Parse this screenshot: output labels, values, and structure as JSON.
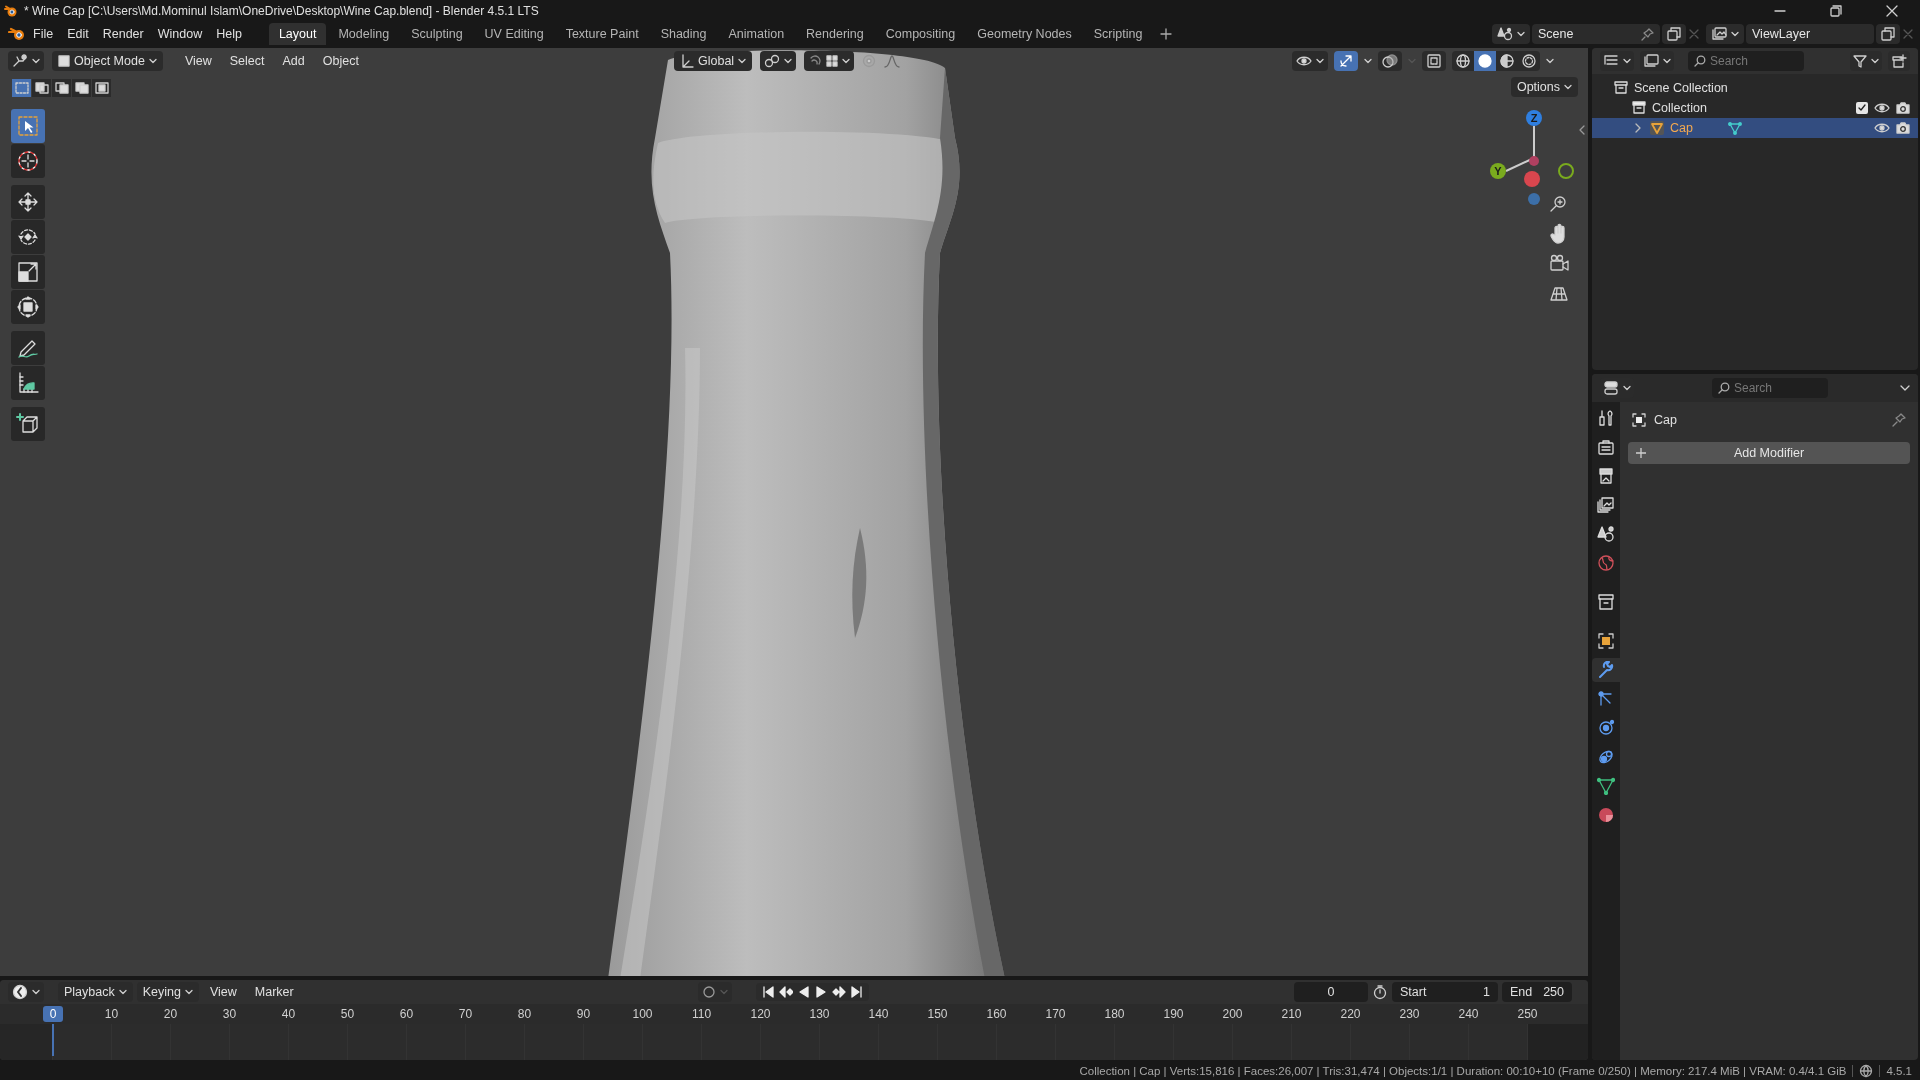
{
  "title_bar": {
    "title": "* Wine Cap [C:\\Users\\Md.Mominul Islam\\OneDrive\\Desktop\\Wine Cap.blend] - Blender 4.5.1 LTS"
  },
  "menu": [
    "File",
    "Edit",
    "Render",
    "Window",
    "Help"
  ],
  "workspaces": [
    {
      "label": "Layout",
      "selected": true
    },
    {
      "label": "Modeling",
      "selected": false
    },
    {
      "label": "Sculpting",
      "selected": false
    },
    {
      "label": "UV Editing",
      "selected": false
    },
    {
      "label": "Texture Paint",
      "selected": false
    },
    {
      "label": "Shading",
      "selected": false
    },
    {
      "label": "Animation",
      "selected": false
    },
    {
      "label": "Rendering",
      "selected": false
    },
    {
      "label": "Compositing",
      "selected": false
    },
    {
      "label": "Geometry Nodes",
      "selected": false
    },
    {
      "label": "Scripting",
      "selected": false
    }
  ],
  "scene": "Scene",
  "view_layer": "ViewLayer",
  "viewport": {
    "mode": "Object Mode",
    "menus": [
      "View",
      "Select",
      "Add",
      "Object"
    ],
    "orientation": "Global",
    "options": "Options",
    "select_modes": [
      {
        "selected": true
      },
      {
        "selected": false
      },
      {
        "selected": false
      },
      {
        "selected": false
      },
      {
        "selected": false
      }
    ],
    "tools": [
      {
        "kind": "select",
        "selected": true
      },
      {
        "kind": "cursor",
        "selected": false
      },
      {
        "kind": "move",
        "selected": false
      },
      {
        "kind": "rotate",
        "selected": false
      },
      {
        "kind": "scale",
        "selected": false
      },
      {
        "kind": "transform",
        "selected": false
      },
      {
        "kind": "annotate",
        "selected": false
      },
      {
        "kind": "measure",
        "selected": false
      },
      {
        "kind": "add-cube",
        "selected": false
      }
    ],
    "shading": [
      {
        "kind": "wireframe",
        "selected": false
      },
      {
        "kind": "solid",
        "selected": true
      },
      {
        "kind": "material",
        "selected": false
      },
      {
        "kind": "rendered",
        "selected": false
      }
    ],
    "gizmo_axes": [
      {
        "label": "Z",
        "color": "#2f7fe0"
      },
      {
        "label": "Y",
        "color": "#7aab1e"
      }
    ],
    "object": {
      "kind": "picture"
    }
  },
  "outliner": {
    "search": {
      "placeholder": "Search"
    },
    "tree": [
      {
        "label": "Scene Collection",
        "kind": "scene",
        "selected": false,
        "children": [
          {
            "label": "Collection",
            "kind": "collection",
            "checked": true,
            "selected": false,
            "children": [
              {
                "label": "Cap",
                "kind": "mesh",
                "selected": true,
                "expanded": false
              }
            ]
          }
        ]
      }
    ]
  },
  "properties": {
    "search": {
      "placeholder": "Search"
    },
    "object": "Cap",
    "add_modifier": "Add Modifier",
    "tabs": [
      {
        "kind": "tool",
        "selected": false
      },
      {
        "kind": "render",
        "selected": false
      },
      {
        "kind": "output",
        "selected": false
      },
      {
        "kind": "view-layer",
        "selected": false
      },
      {
        "kind": "scene",
        "selected": false
      },
      {
        "kind": "world",
        "selected": false
      },
      {
        "kind": "collection",
        "selected": false
      },
      {
        "kind": "object",
        "selected": false
      },
      {
        "kind": "modifiers",
        "selected": true
      },
      {
        "kind": "particles",
        "selected": false
      },
      {
        "kind": "physics",
        "selected": false
      },
      {
        "kind": "constraints",
        "selected": false
      },
      {
        "kind": "data",
        "selected": false
      },
      {
        "kind": "material",
        "selected": false
      }
    ]
  },
  "timeline": {
    "menus": [
      "Playback",
      "Keying",
      "View",
      "Marker"
    ],
    "current_frame": "0",
    "start_label": "Start",
    "start": "1",
    "end_label": "End",
    "end": "250",
    "playhead": "0",
    "ticks": [
      "10",
      "20",
      "30",
      "40",
      "50",
      "60",
      "70",
      "80",
      "90",
      "100",
      "110",
      "120",
      "130",
      "140",
      "150",
      "160",
      "170",
      "180",
      "190",
      "200",
      "210",
      "220",
      "230",
      "240",
      "250"
    ]
  },
  "status_bar": {
    "stats": "Collection | Cap | Verts:15,816 | Faces:26,007 | Tris:31,474 | Objects:1/1 | Duration: 00:10+10 (Frame 0/250) | Memory: 217.4 MiB | VRAM: 0.4/4.1 GiB",
    "version": "4.5.1"
  }
}
